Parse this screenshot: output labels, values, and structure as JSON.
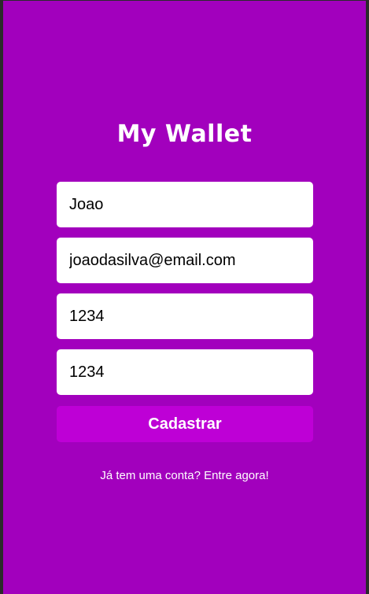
{
  "app": {
    "title": "My Wallet"
  },
  "form": {
    "name_value": "Joao",
    "email_value": "joaodasilva@email.com",
    "password_value": "1234",
    "confirm_password_value": "1234",
    "submit_label": "Cadastrar"
  },
  "footer": {
    "login_link": "Já tem uma conta? Entre agora!"
  },
  "colors": {
    "background": "#a200bd",
    "button": "#be00d6",
    "input_background": "#ffffff",
    "text": "#ffffff"
  }
}
